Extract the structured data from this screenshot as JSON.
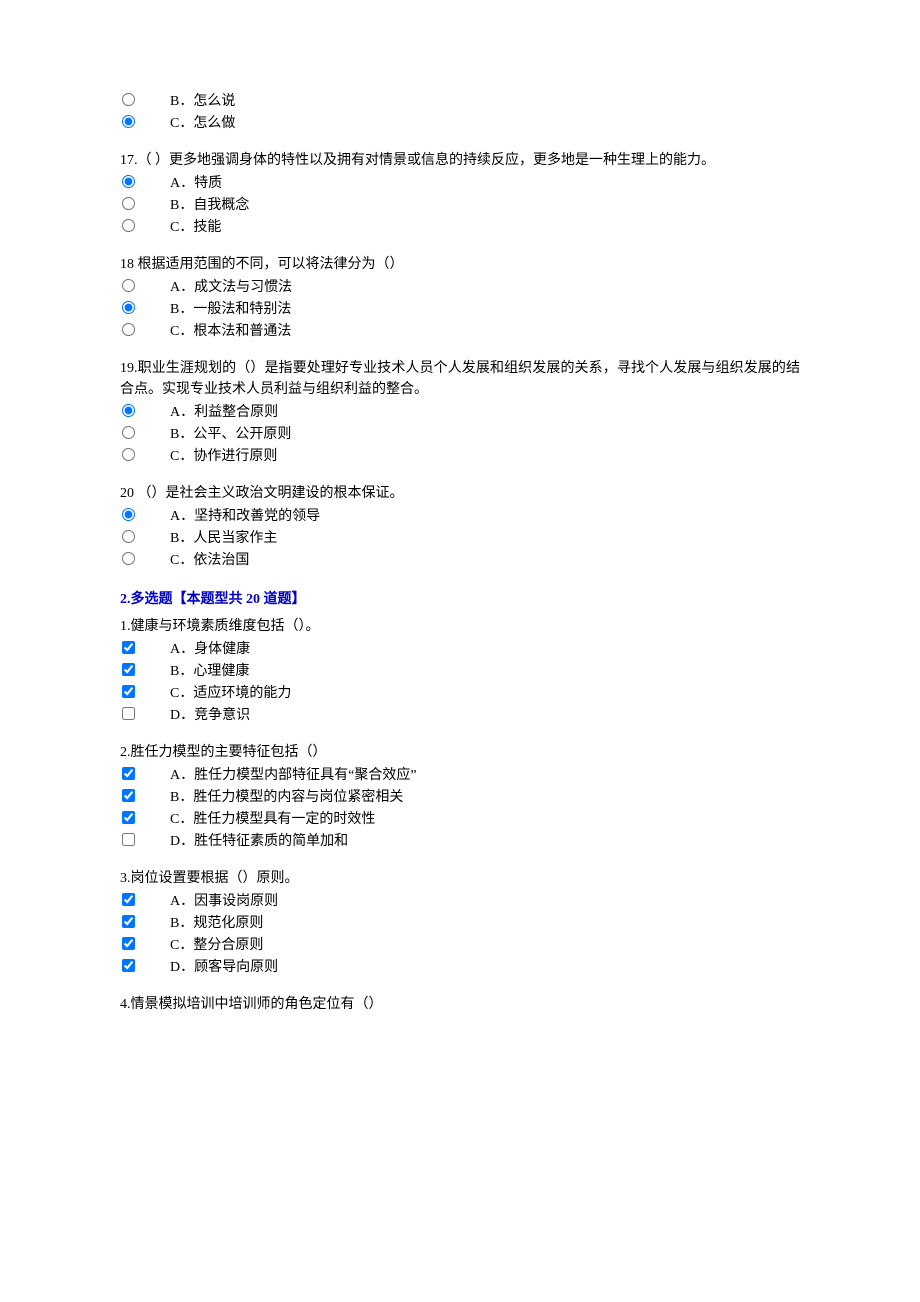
{
  "q16": {
    "options": [
      {
        "letter": "B",
        "text": "怎么说",
        "checked": false
      },
      {
        "letter": "C",
        "text": "怎么做",
        "checked": true
      }
    ]
  },
  "q17": {
    "prompt": "17.（ ）更多地强调身体的特性以及拥有对情景或信息的持续反应，更多地是一种生理上的能力。",
    "options": [
      {
        "letter": "A",
        "text": "特质",
        "checked": true
      },
      {
        "letter": "B",
        "text": "自我概念",
        "checked": false
      },
      {
        "letter": "C",
        "text": "技能",
        "checked": false
      }
    ]
  },
  "q18": {
    "prompt": "18 根据适用范围的不同，可以将法律分为（）",
    "options": [
      {
        "letter": "A",
        "text": "成文法与习惯法",
        "checked": false
      },
      {
        "letter": "B",
        "text": "一般法和特别法",
        "checked": true
      },
      {
        "letter": "C",
        "text": "根本法和普通法",
        "checked": false
      }
    ]
  },
  "q19": {
    "prompt": "19.职业生涯规划的（）是指要处理好专业技术人员个人发展和组织发展的关系，寻找个人发展与组织发展的结合点。实现专业技术人员利益与组织利益的整合。",
    "options": [
      {
        "letter": "A",
        "text": "利益整合原则",
        "checked": true
      },
      {
        "letter": "B",
        "text": "公平、公开原则",
        "checked": false
      },
      {
        "letter": "C",
        "text": "协作进行原则",
        "checked": false
      }
    ]
  },
  "q20": {
    "prompt": "20 （）是社会主义政治文明建设的根本保证。",
    "options": [
      {
        "letter": "A",
        "text": "坚持和改善党的领导",
        "checked": true
      },
      {
        "letter": "B",
        "text": "人民当家作主",
        "checked": false
      },
      {
        "letter": "C",
        "text": "依法治国",
        "checked": false
      }
    ]
  },
  "section2_title": "2.多选题【本题型共 20 道题】",
  "m1": {
    "prompt": "1.健康与环境素质维度包括（）。",
    "options": [
      {
        "letter": "A",
        "text": "身体健康",
        "checked": true
      },
      {
        "letter": "B",
        "text": "心理健康",
        "checked": true
      },
      {
        "letter": "C",
        "text": "适应环境的能力",
        "checked": true
      },
      {
        "letter": "D",
        "text": "竞争意识",
        "checked": false
      }
    ]
  },
  "m2": {
    "prompt": "2.胜任力模型的主要特征包括（）",
    "options": [
      {
        "letter": "A",
        "text": "胜任力模型内部特征具有“聚合效应”",
        "checked": true
      },
      {
        "letter": "B",
        "text": "胜任力模型的内容与岗位紧密相关",
        "checked": true
      },
      {
        "letter": "C",
        "text": "胜任力模型具有一定的时效性",
        "checked": true
      },
      {
        "letter": "D",
        "text": "胜任特征素质的简单加和",
        "checked": false
      }
    ]
  },
  "m3": {
    "prompt": "3.岗位设置要根据（）原则。",
    "options": [
      {
        "letter": "A",
        "text": "因事设岗原则",
        "checked": true
      },
      {
        "letter": "B",
        "text": "规范化原则",
        "checked": true
      },
      {
        "letter": "C",
        "text": "整分合原则",
        "checked": true
      },
      {
        "letter": "D",
        "text": "顾客导向原则",
        "checked": true
      }
    ]
  },
  "m4": {
    "prompt": "4.情景模拟培训中培训师的角色定位有（）"
  }
}
